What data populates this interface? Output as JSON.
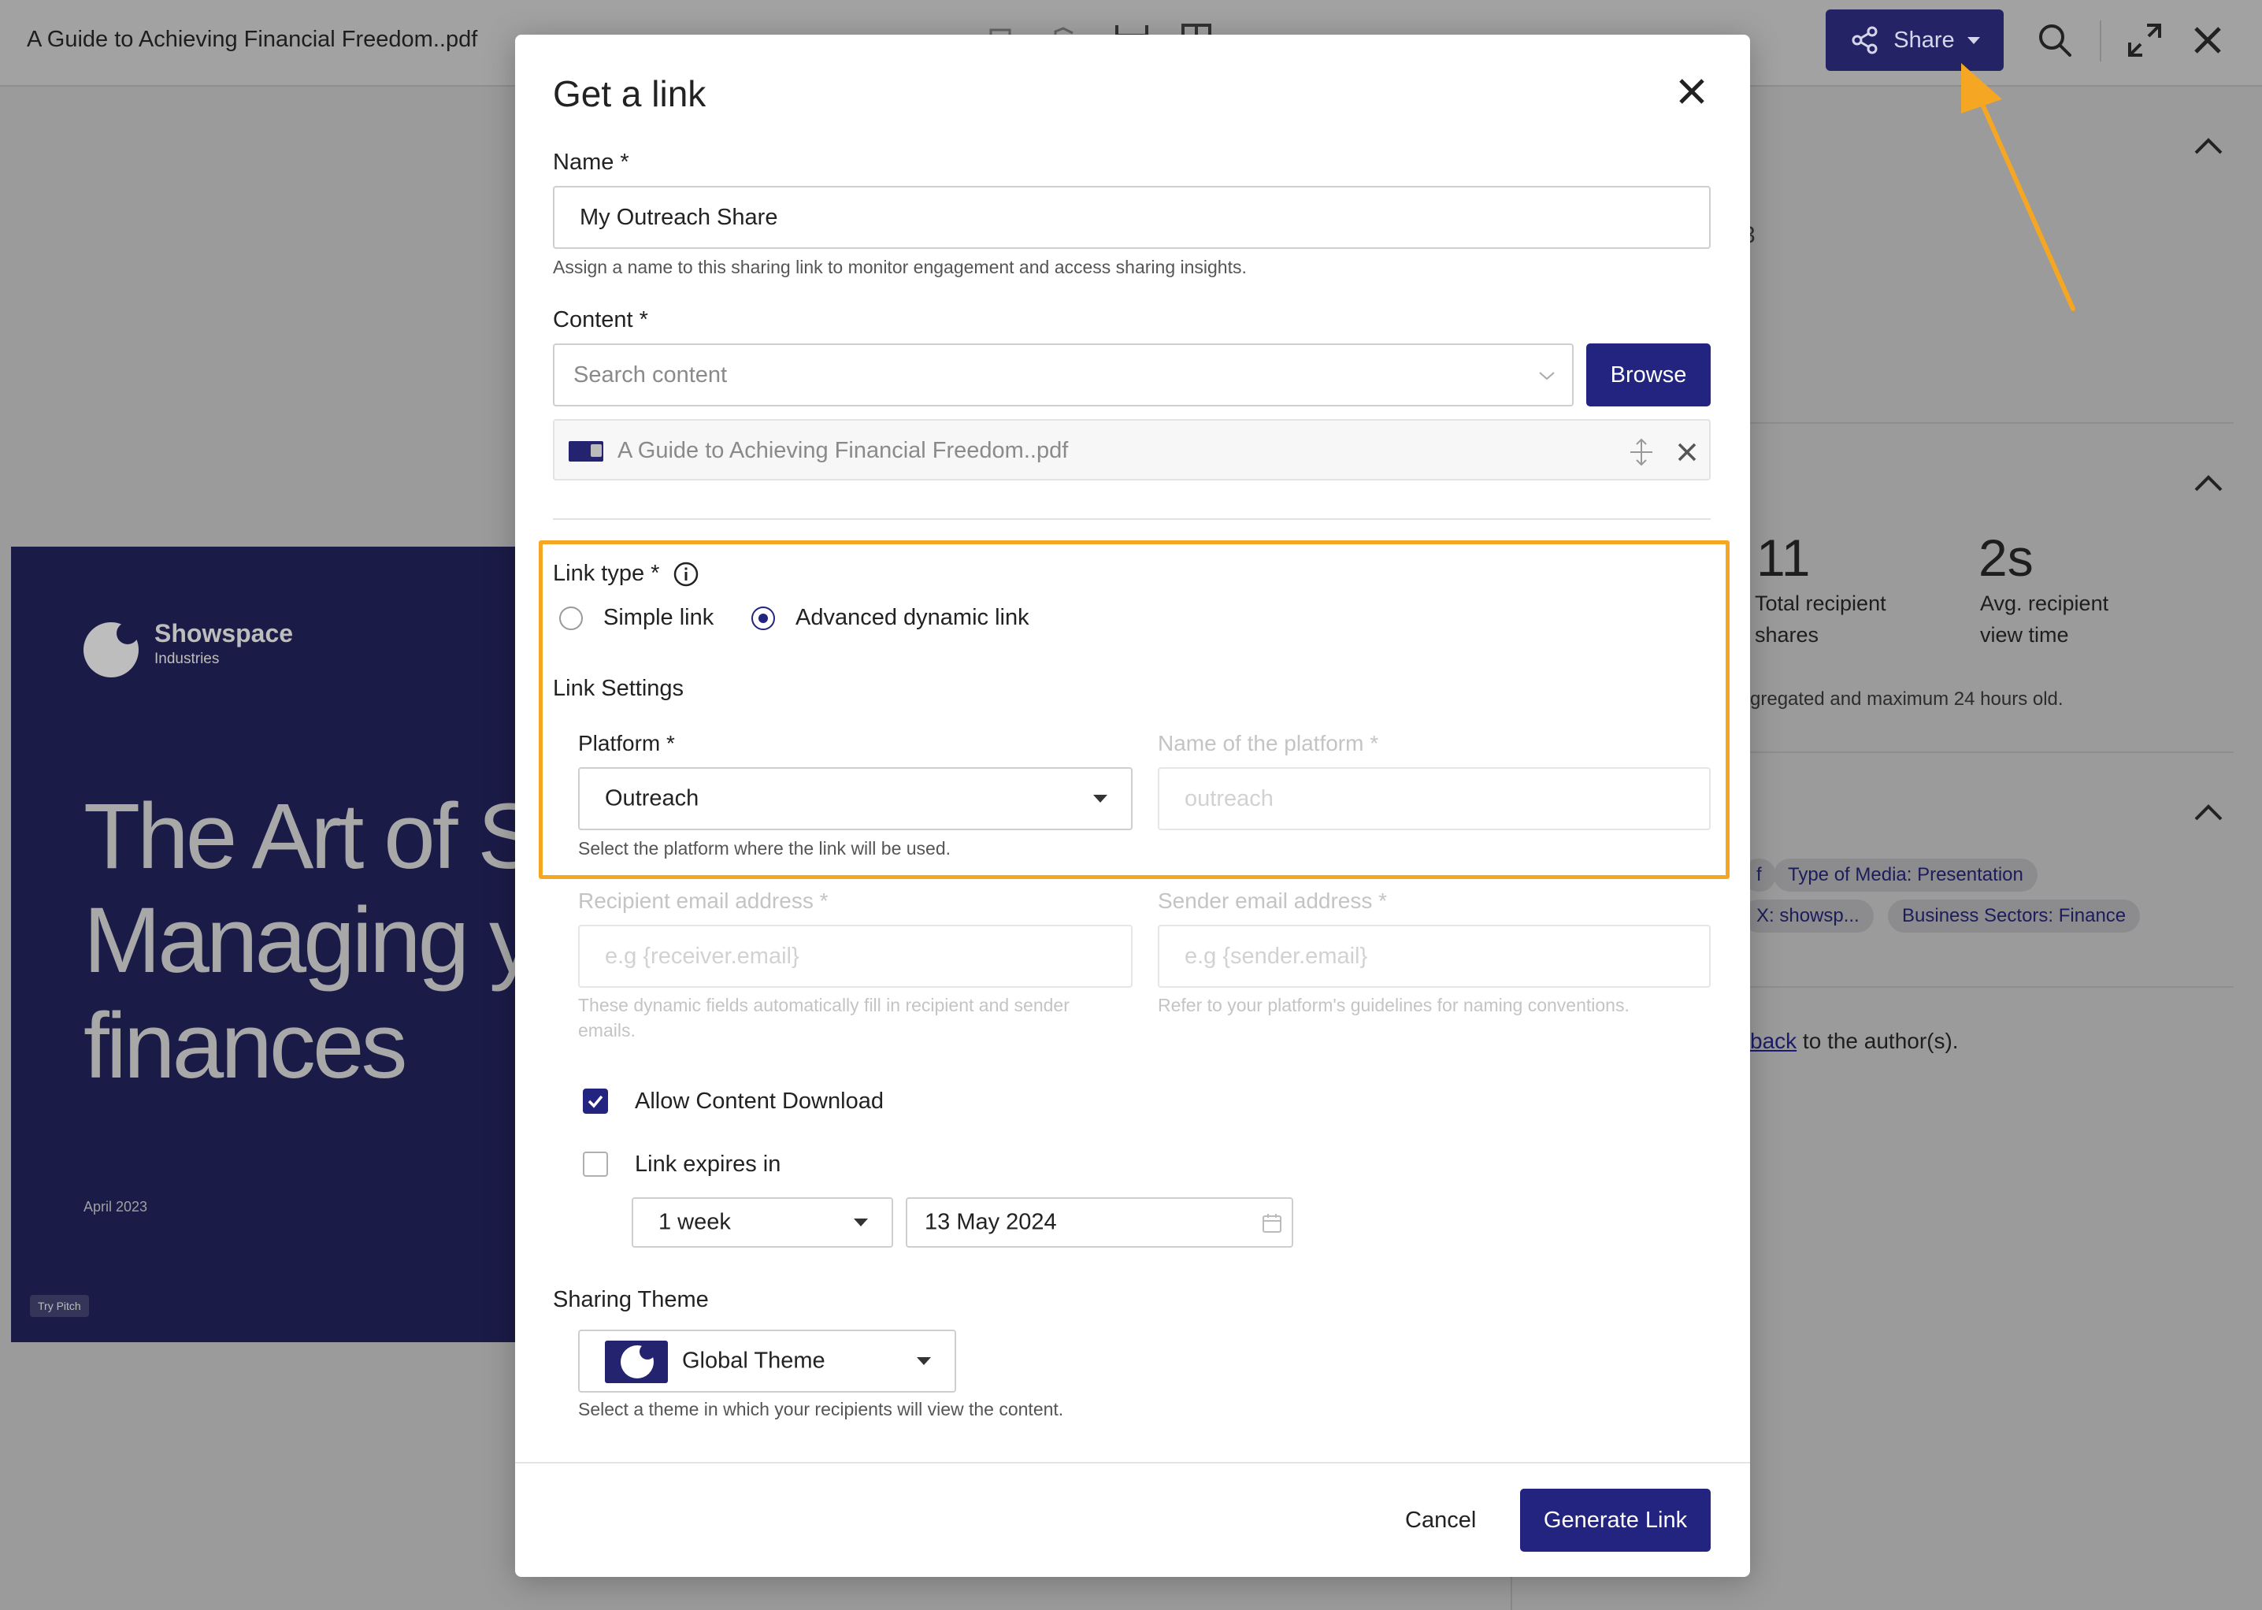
{
  "header": {
    "doc_title": "A Guide to Achieving Financial Freedom..pdf",
    "share_label": "Share",
    "icons": [
      "share-icon",
      "search-icon",
      "expand-icon",
      "close-icon"
    ]
  },
  "right_panel": {
    "stat_shares_value": "11",
    "stat_shares_label_1": "Total recipient",
    "stat_shares_label_2": "shares",
    "stat_time_value": "2s",
    "stat_time_label_1": "Avg. recipient",
    "stat_time_label_2": "view time",
    "note": "gregated and maximum 24 hours old.",
    "partial_char": "3",
    "tags": [
      {
        "label": "f"
      },
      {
        "label": "Type of Media: Presentation"
      },
      {
        "label": "X: showsp..."
      },
      {
        "label": "Business Sectors: Finance"
      }
    ],
    "feedback_link": "back",
    "feedback_rest": " to the author(s)."
  },
  "slide": {
    "brand_name": "Showspace",
    "brand_sub": "Industries",
    "line1": "The Art of Sa",
    "line2": "Managing y",
    "line3": "finances",
    "date": "April 2023",
    "badge": "Try Pitch"
  },
  "modal": {
    "title": "Get a link",
    "name": {
      "label": "Name *",
      "value": "My Outreach Share",
      "help": "Assign a name to this sharing link to monitor engagement and access sharing insights."
    },
    "content": {
      "label": "Content *",
      "search_placeholder": "Search content",
      "browse_label": "Browse",
      "selected_item": "A Guide to Achieving Financial Freedom..pdf"
    },
    "link_type": {
      "label": "Link type *",
      "options": [
        "Simple link",
        "Advanced dynamic link"
      ],
      "selected": "Advanced dynamic link"
    },
    "link_settings": {
      "heading": "Link Settings",
      "platform_label": "Platform *",
      "platform_value": "Outreach",
      "platform_help": "Select the platform where the link will be used.",
      "platform_name_label": "Name of the platform *",
      "platform_name_placeholder": "outreach",
      "recipient_label": "Recipient email address *",
      "recipient_placeholder": "e.g {receiver.email}",
      "recipient_help_1": "These dynamic fields automatically fill in recipient and sender",
      "recipient_help_2": "emails.",
      "sender_label": "Sender email address *",
      "sender_placeholder": "e.g {sender.email}",
      "sender_help": "Refer to your platform's guidelines for naming conventions."
    },
    "options": {
      "allow_download_label": "Allow Content Download",
      "allow_download_checked": true,
      "expires_label": "Link expires in",
      "expires_checked": false,
      "expires_duration": "1 week",
      "expires_date": "13 May 2024"
    },
    "theme": {
      "label": "Sharing Theme",
      "value": "Global Theme",
      "help": "Select a theme in which your recipients will view the content."
    },
    "footer": {
      "cancel_label": "Cancel",
      "generate_label": "Generate Link"
    }
  },
  "colors": {
    "accent": "#232380",
    "highlight": "#f5a623",
    "backdrop": "#9b9b9b"
  }
}
